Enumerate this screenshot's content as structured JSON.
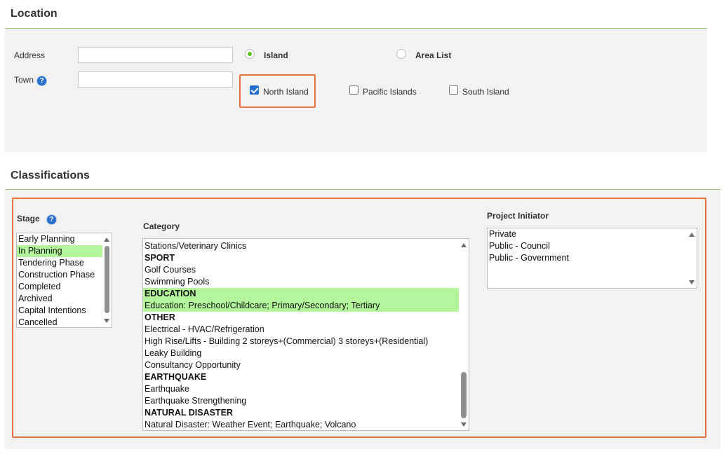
{
  "location": {
    "title": "Location",
    "address_label": "Address",
    "address_value": "",
    "town_label": "Town",
    "town_value": "",
    "help_glyph": "?",
    "radio_island": "Island",
    "radio_area_list": "Area List",
    "checkbox_north": "North Island",
    "checkbox_pacific": "Pacific Islands",
    "checkbox_south": "South Island"
  },
  "classifications": {
    "title": "Classifications",
    "stage_label": "Stage",
    "stage_items": [
      {
        "label": "Early Planning",
        "selected": false
      },
      {
        "label": "In Planning",
        "selected": true
      },
      {
        "label": "Tendering Phase",
        "selected": false
      },
      {
        "label": "Construction Phase",
        "selected": false
      },
      {
        "label": "Completed",
        "selected": false
      },
      {
        "label": "Archived",
        "selected": false
      },
      {
        "label": "Capital Intentions",
        "selected": false
      },
      {
        "label": "Cancelled",
        "selected": false
      }
    ],
    "category_label": "Category",
    "category_items": [
      {
        "label": "Stations/Veterinary Clinics",
        "group": false,
        "selected": false
      },
      {
        "label": "SPORT",
        "group": true,
        "selected": false
      },
      {
        "label": "Golf Courses",
        "group": false,
        "selected": false
      },
      {
        "label": "Swimming Pools",
        "group": false,
        "selected": false
      },
      {
        "label": "EDUCATION",
        "group": true,
        "selected": true
      },
      {
        "label": "Education: Preschool/Childcare; Primary/Secondary; Tertiary",
        "group": false,
        "selected": true
      },
      {
        "label": "OTHER",
        "group": true,
        "selected": false
      },
      {
        "label": "Electrical - HVAC/Refrigeration",
        "group": false,
        "selected": false
      },
      {
        "label": "High Rise/Lifts - Building 2 storeys+(Commercial) 3 storeys+(Residential)",
        "group": false,
        "selected": false
      },
      {
        "label": "Leaky Building",
        "group": false,
        "selected": false
      },
      {
        "label": "Consultancy Opportunity",
        "group": false,
        "selected": false
      },
      {
        "label": "EARTHQUAKE",
        "group": true,
        "selected": false
      },
      {
        "label": "Earthquake",
        "group": false,
        "selected": false
      },
      {
        "label": "Earthquake Strengthening",
        "group": false,
        "selected": false
      },
      {
        "label": "NATURAL DISASTER",
        "group": true,
        "selected": false
      },
      {
        "label": "Natural Disaster: Weather Event; Earthquake; Volcano",
        "group": false,
        "selected": false
      }
    ],
    "initiator_label": "Project Initiator",
    "initiator_items": [
      {
        "label": "Private",
        "selected": false
      },
      {
        "label": "Public - Council",
        "selected": false
      },
      {
        "label": "Public - Government",
        "selected": false
      }
    ]
  },
  "colors": {
    "accent_green": "#9cd07a",
    "selection_green": "#b2f59a",
    "highlight_orange": "#e8703f",
    "panel_gray": "#f2f2f0"
  }
}
